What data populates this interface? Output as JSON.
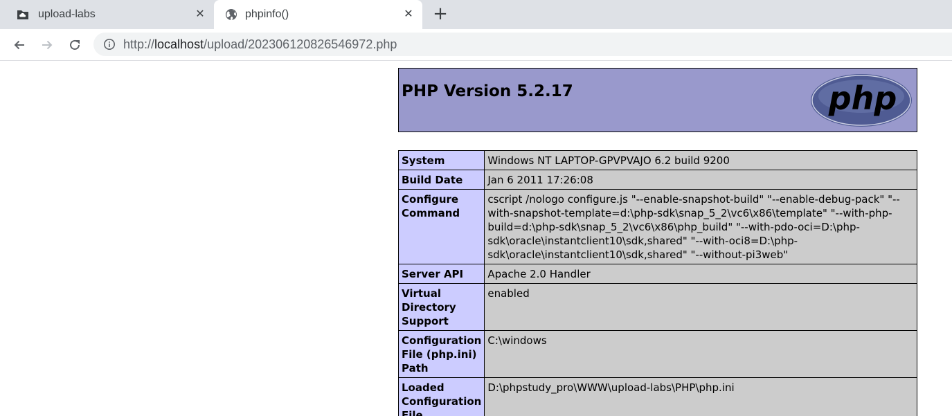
{
  "browser": {
    "tabs": [
      {
        "title": "upload-labs",
        "icon": "folder-cloud-icon",
        "active": false
      },
      {
        "title": "phpinfo()",
        "icon": "globe-icon",
        "active": true
      }
    ],
    "close_glyph": "✕",
    "new_tab_glyph": "+",
    "url": {
      "scheme": "http://",
      "host": "localhost",
      "path": "/upload/202306120826546972.php"
    }
  },
  "phpinfo": {
    "version_title": "PHP Version 5.2.17",
    "logo_text": "php",
    "rows": [
      {
        "key": "System",
        "value": "Windows NT LAPTOP-GPVPVAJO 6.2 build 9200"
      },
      {
        "key": "Build Date",
        "value": "Jan 6 2011 17:26:08"
      },
      {
        "key": "Configure Command",
        "value": "cscript /nologo configure.js \"--enable-snapshot-build\" \"--enable-debug-pack\" \"--with-snapshot-template=d:\\php-sdk\\snap_5_2\\vc6\\x86\\template\" \"--with-php-build=d:\\php-sdk\\snap_5_2\\vc6\\x86\\php_build\" \"--with-pdo-oci=D:\\php-sdk\\oracle\\instantclient10\\sdk,shared\" \"--with-oci8=D:\\php-sdk\\oracle\\instantclient10\\sdk,shared\" \"--without-pi3web\""
      },
      {
        "key": "Server API",
        "value": "Apache 2.0 Handler"
      },
      {
        "key": "Virtual Directory Support",
        "value": "enabled"
      },
      {
        "key": "Configuration File (php.ini) Path",
        "value": "C:\\windows"
      },
      {
        "key": "Loaded Configuration File",
        "value": "D:\\phpstudy_pro\\WWW\\upload-labs\\PHP\\php.ini"
      }
    ]
  },
  "colors": {
    "header_bg": "#9999cc",
    "key_cell_bg": "#ccccff",
    "value_cell_bg": "#cccccc"
  }
}
